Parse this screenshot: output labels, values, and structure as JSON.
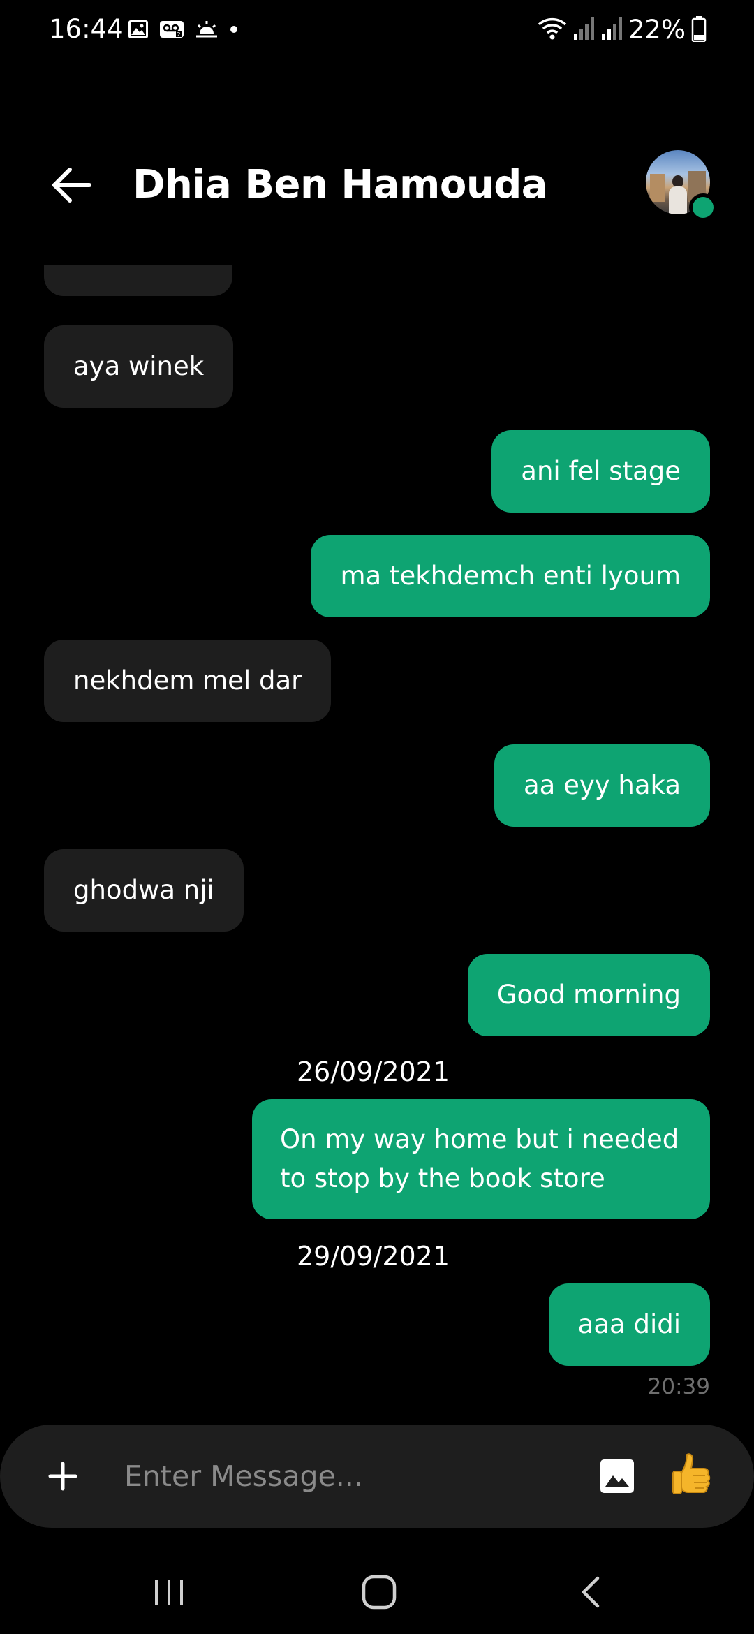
{
  "status_bar": {
    "time": "16:44",
    "battery": "22%",
    "icons_left": [
      "gallery-icon",
      "voicemail-icon",
      "weather-icon",
      "dot-icon"
    ],
    "icons_right": [
      "wifi-icon",
      "signal-icon",
      "signal-icon",
      "battery-icon"
    ]
  },
  "header": {
    "contact_name": "Dhia Ben Hamouda",
    "online": true
  },
  "messages": [
    {
      "side": "in",
      "text": ""
    },
    {
      "side": "in",
      "text": "aya winek"
    },
    {
      "side": "out",
      "text": "ani fel stage"
    },
    {
      "side": "out",
      "text": "ma tekhdemch enti lyoum"
    },
    {
      "side": "in",
      "text": "nekhdem mel dar"
    },
    {
      "side": "out",
      "text": "aa eyy haka"
    },
    {
      "side": "in",
      "text": "ghodwa nji"
    },
    {
      "side": "out",
      "text": "Good morning"
    },
    {
      "type": "date",
      "text": "26/09/2021"
    },
    {
      "side": "out",
      "text": "On my way home but i needed to stop by the book store"
    },
    {
      "type": "date",
      "text": "29/09/2021"
    },
    {
      "side": "out",
      "text": "aaa didi"
    },
    {
      "type": "time",
      "text": "20:39"
    }
  ],
  "composer": {
    "placeholder": "Enter Message...",
    "value": ""
  },
  "colors": {
    "background": "#000000",
    "incoming_bubble": "#1e1e1e",
    "outgoing_bubble": "#0ea472",
    "online_dot": "#0ea472",
    "composer": "#1e1e1e",
    "timestamp": "#6e6e6e",
    "placeholder": "#8a8a8a"
  }
}
